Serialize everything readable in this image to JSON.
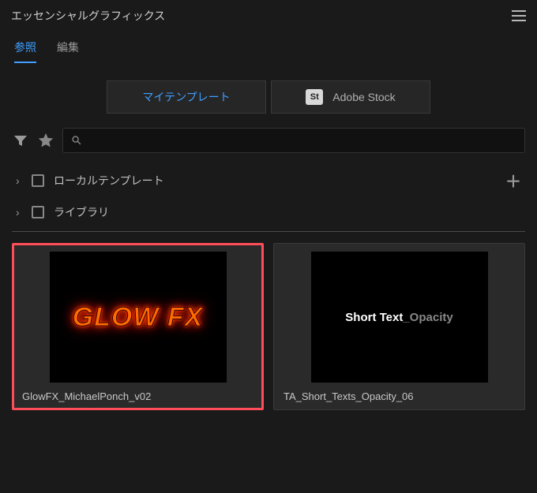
{
  "header": {
    "title": "エッセンシャルグラフィックス"
  },
  "tabs": {
    "browse": "参照",
    "edit": "編集"
  },
  "sources": {
    "my_templates": "マイテンプレート",
    "adobe_stock": "Adobe Stock",
    "stock_badge": "St"
  },
  "search": {
    "placeholder": ""
  },
  "folders": {
    "local": "ローカルテンプレート",
    "libraries": "ライブラリ"
  },
  "templates": [
    {
      "label": "GlowFX_MichaelPonch_v02",
      "preview_text": "GLOW FX",
      "selected": true
    },
    {
      "label": "TA_Short_Texts_Opacity_06",
      "preview_main": "Short Text",
      "preview_suffix": "_Opacity",
      "selected": false
    }
  ]
}
